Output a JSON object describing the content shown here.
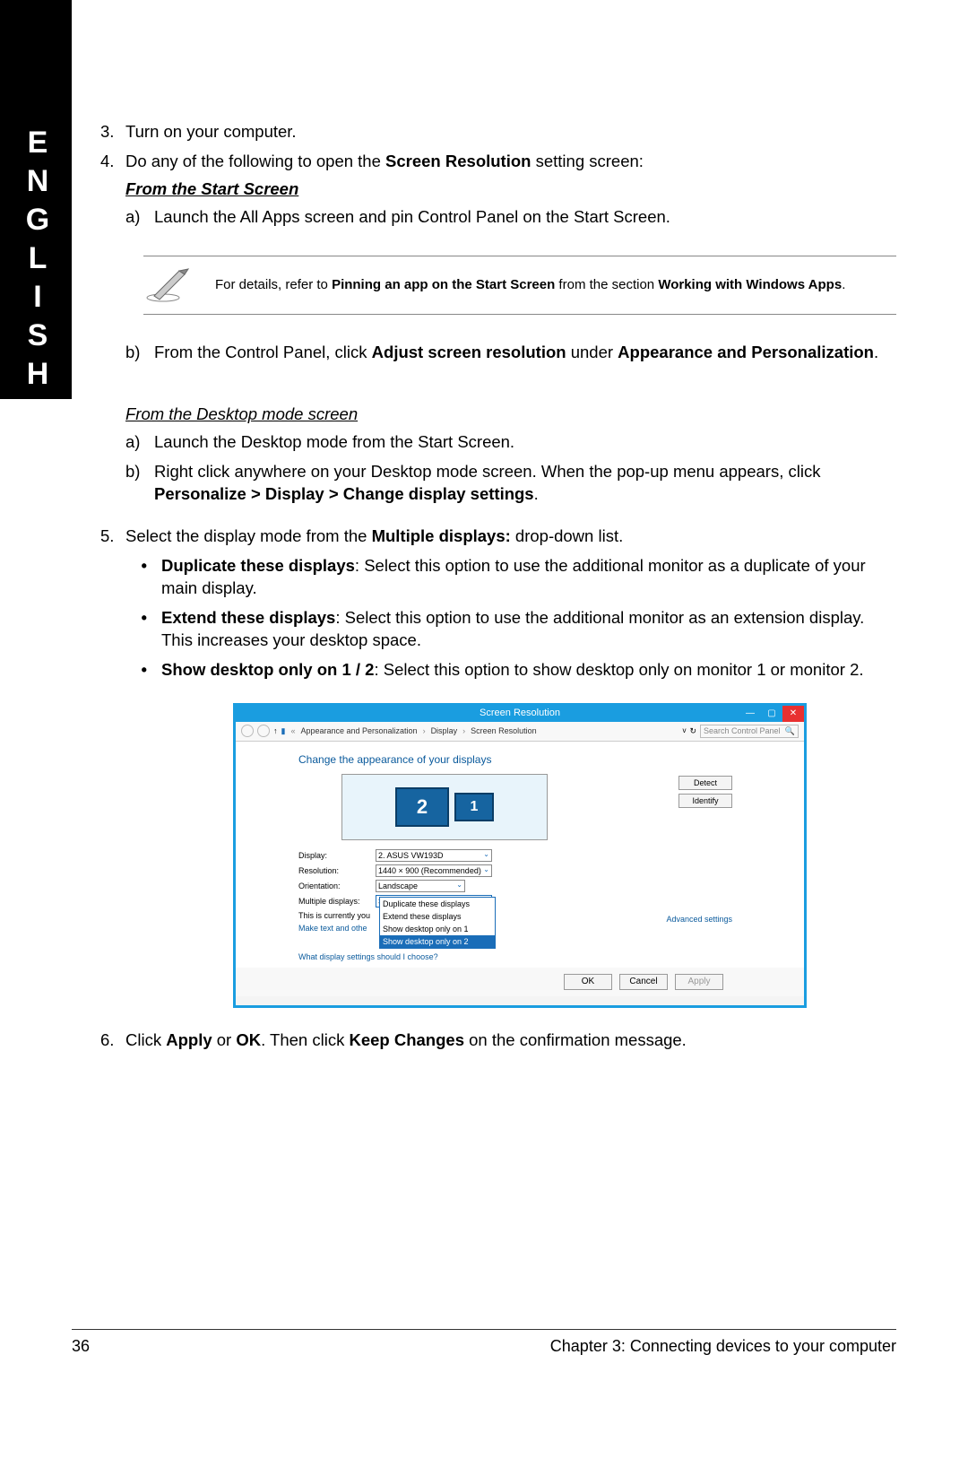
{
  "lang_tab": "ENGLISH",
  "steps": {
    "s3_num": "3.",
    "s3_text": "Turn on your computer.",
    "s4_num": "4.",
    "s4_pre": "Do any of the following to open the ",
    "s4_bold": "Screen Resolution",
    "s4_post": " setting screen:",
    "from_start": "From the Start Screen",
    "s4a_mark": "a)",
    "s4a_text": "Launch the All Apps screen and pin Control Panel on the Start Screen.",
    "note_pre": "For details, refer to ",
    "note_b1": "Pinning an app on the Start Screen",
    "note_mid": " from the section ",
    "note_b2": "Working with Windows Apps",
    "note_post": ".",
    "s4b_mark": "b)",
    "s4b_pre": "From the Control Panel, click ",
    "s4b_b1": "Adjust screen resolution",
    "s4b_mid": " under ",
    "s4b_b2": "Appearance and Personalization",
    "s4b_post": ".",
    "from_desktop": "From the Desktop mode screen",
    "da_mark": "a)",
    "da_text": "Launch the Desktop mode from the Start Screen.",
    "db_mark": "b)",
    "db_pre": "Right click anywhere on your Desktop mode screen. When the pop-up menu appears, click ",
    "db_b": "Personalize > Display > Change display settings",
    "db_post": ".",
    "s5_num": "5.",
    "s5_pre": "Select the display mode from the ",
    "s5_b": "Multiple displays:",
    "s5_post": " drop-down list.",
    "bul1_b": "Duplicate these displays",
    "bul1_t": ": Select this option to use the additional monitor as a duplicate of your main display.",
    "bul2_b": "Extend these displays",
    "bul2_t": ": Select this option to use the additional monitor as an extension display. This increases your desktop space.",
    "bul3_b": "Show desktop only on 1 / 2",
    "bul3_t": ": Select this option to show desktop only on monitor 1 or monitor 2.",
    "s6_num": "6.",
    "s6_pre": "Click ",
    "s6_b1": "Apply",
    "s6_mid1": " or ",
    "s6_b2": "OK",
    "s6_mid2": ". Then click ",
    "s6_b3": "Keep Changes",
    "s6_post": " on the confirmation message."
  },
  "screenshot": {
    "title": "Screen Resolution",
    "crumb1": "Appearance and Personalization",
    "crumb2": "Display",
    "crumb3": "Screen Resolution",
    "search_ph": "Search Control Panel",
    "heading": "Change the appearance of your displays",
    "btn_detect": "Detect",
    "btn_identify": "Identify",
    "mon1": "1",
    "mon2": "2",
    "lbl_display": "Display:",
    "val_display": "2. ASUS VW193D",
    "lbl_res": "Resolution:",
    "val_res": "1440 × 900 (Recommended)",
    "lbl_orient": "Orientation:",
    "val_orient": "Landscape",
    "lbl_multi": "Multiple displays:",
    "val_multi": "Show desktop only on 2",
    "dd1": "Duplicate these displays",
    "dd2": "Extend these displays",
    "dd3": "Show desktop only on 1",
    "dd4": "Show desktop only on 2",
    "main_note_pre": "This is currently you",
    "make_text": "Make text and othe",
    "adv": "Advanced settings",
    "help": "What display settings should I choose?",
    "ok": "OK",
    "cancel": "Cancel",
    "apply": "Apply"
  },
  "footer": {
    "page": "36",
    "chapter": "Chapter 3: Connecting devices to your computer"
  }
}
